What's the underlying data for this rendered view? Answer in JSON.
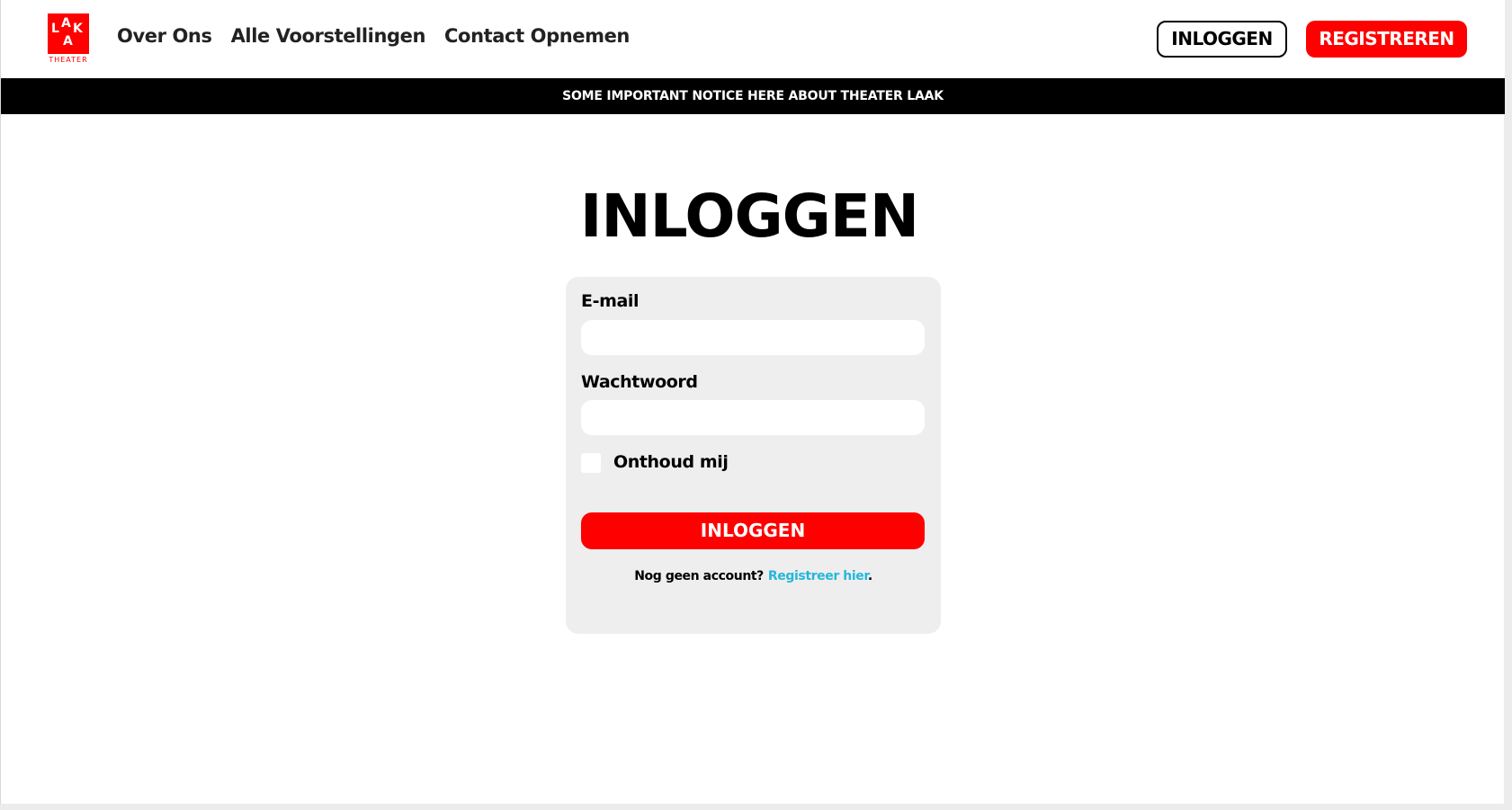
{
  "logo": {
    "letters": [
      "L",
      "A",
      "K",
      "A"
    ],
    "caption": "THEATER",
    "brand_color": "#ff0000"
  },
  "nav": {
    "items": [
      "Over Ons",
      "Alle Voorstellingen",
      "Contact Opnemen"
    ]
  },
  "header_buttons": {
    "login_label": "INLOGGEN",
    "register_label": "REGISTREREN"
  },
  "notice": {
    "text": "SOME IMPORTANT NOTICE HERE ABOUT THEATER LAAK"
  },
  "page_title": "INLOGGEN",
  "form": {
    "email_label": "E-mail",
    "email_value": "",
    "password_label": "Wachtwoord",
    "password_value": "",
    "remember_label": "Onthoud mij",
    "remember_checked": false,
    "submit_label": "INLOGGEN",
    "no_account_text": "Nog geen account?",
    "register_link": "Registreer hier",
    "register_suffix": "."
  },
  "colors": {
    "accent": "#ff0000",
    "link": "#26b7d9",
    "notice_bg": "#000000",
    "card_bg": "#eeeeee"
  }
}
